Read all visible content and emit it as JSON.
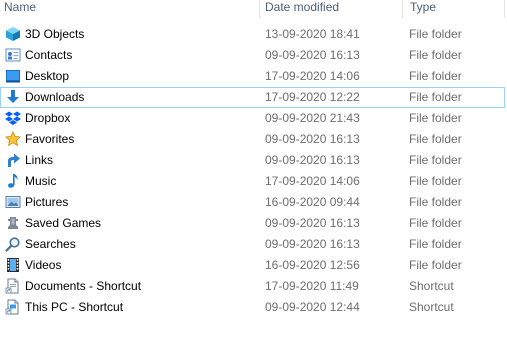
{
  "columns": {
    "name": "Name",
    "date": "Date modified",
    "type": "Type"
  },
  "selected_index": 3,
  "rows": [
    {
      "name": "3D Objects",
      "date": "13-09-2020 18:41",
      "type": "File folder",
      "icon": "3d-objects-icon"
    },
    {
      "name": "Contacts",
      "date": "09-09-2020 16:13",
      "type": "File folder",
      "icon": "contacts-icon"
    },
    {
      "name": "Desktop",
      "date": "17-09-2020 14:06",
      "type": "File folder",
      "icon": "desktop-icon"
    },
    {
      "name": "Downloads",
      "date": "17-09-2020 12:22",
      "type": "File folder",
      "icon": "downloads-icon"
    },
    {
      "name": "Dropbox",
      "date": "09-09-2020 21:43",
      "type": "File folder",
      "icon": "dropbox-icon"
    },
    {
      "name": "Favorites",
      "date": "09-09-2020 16:13",
      "type": "File folder",
      "icon": "favorites-icon"
    },
    {
      "name": "Links",
      "date": "09-09-2020 16:13",
      "type": "File folder",
      "icon": "links-icon"
    },
    {
      "name": "Music",
      "date": "17-09-2020 14:06",
      "type": "File folder",
      "icon": "music-icon"
    },
    {
      "name": "Pictures",
      "date": "16-09-2020 09:44",
      "type": "File folder",
      "icon": "pictures-icon"
    },
    {
      "name": "Saved Games",
      "date": "09-09-2020 16:13",
      "type": "File folder",
      "icon": "saved-games-icon"
    },
    {
      "name": "Searches",
      "date": "09-09-2020 16:13",
      "type": "File folder",
      "icon": "searches-icon"
    },
    {
      "name": "Videos",
      "date": "16-09-2020 12:56",
      "type": "File folder",
      "icon": "videos-icon"
    },
    {
      "name": "Documents - Shortcut",
      "date": "17-09-2020 11:49",
      "type": "Shortcut",
      "icon": "document-shortcut-icon"
    },
    {
      "name": "This PC - Shortcut",
      "date": "09-09-2020 12:44",
      "type": "Shortcut",
      "icon": "this-pc-shortcut-icon"
    }
  ],
  "colors": {
    "header_text": "#4c607a",
    "selection_border": "#99d1ff",
    "secondary_text": "#6d6d6d"
  }
}
